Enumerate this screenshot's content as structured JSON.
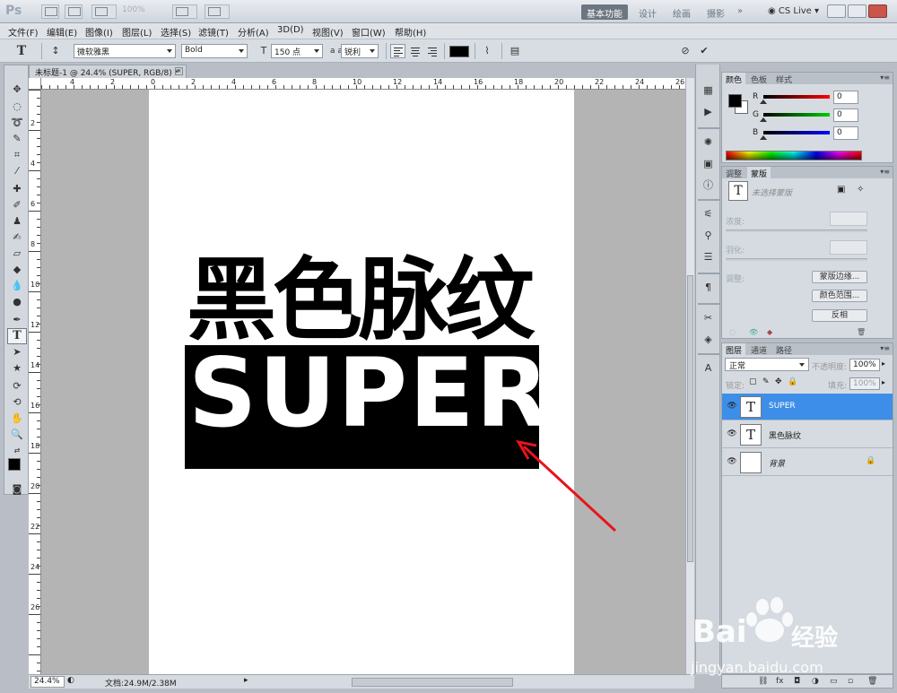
{
  "app": {
    "logo": "Ps",
    "zoom_level": "100%",
    "workspaces": [
      "基本功能",
      "设计",
      "绘画",
      "摄影"
    ],
    "cs_live": "CS Live"
  },
  "menu": [
    "文件(F)",
    "编辑(E)",
    "图像(I)",
    "图层(L)",
    "选择(S)",
    "滤镜(T)",
    "分析(A)",
    "3D(D)",
    "视图(V)",
    "窗口(W)",
    "帮助(H)"
  ],
  "options": {
    "font_family": "微软雅黑",
    "font_style": "Bold",
    "font_size": "150 点",
    "aa_label": "a a",
    "anti_alias": "锐利",
    "text_color": "#000000"
  },
  "document": {
    "tab_title": "未标题-1 @ 24.4% (SUPER, RGB/8) *",
    "headline": "黑色脉纹",
    "box_text": "SUPER",
    "zoom_status": "24.4%",
    "doc_status": "文档:24.9M/2.38M",
    "ruler_top": [
      "4",
      "2",
      "0",
      "2",
      "4",
      "6",
      "8",
      "10",
      "12",
      "14",
      "16",
      "18",
      "20",
      "22",
      "24",
      "26"
    ],
    "ruler_left": [
      "2",
      "4",
      "6",
      "8",
      "10",
      "12",
      "14",
      "16",
      "18",
      "20",
      "22",
      "24",
      "26"
    ]
  },
  "color_panel": {
    "tabs": [
      "颜色",
      "色板",
      "样式"
    ],
    "r": {
      "label": "R",
      "value": "0"
    },
    "g": {
      "label": "G",
      "value": "0"
    },
    "b": {
      "label": "B",
      "value": "0"
    }
  },
  "masks_panel": {
    "tabs": [
      "调整",
      "蒙版"
    ],
    "note": "未选择蒙版",
    "density_label": "浓度:",
    "feather_label": "羽化:",
    "refine_label": "调整:",
    "btn_mask_edge": "蒙版边缘...",
    "btn_color_range": "颜色范围...",
    "btn_invert": "反相"
  },
  "layers_panel": {
    "tabs": [
      "图层",
      "通道",
      "路径"
    ],
    "blend_mode": "正常",
    "opacity_label": "不透明度:",
    "opacity": "100%",
    "lock_label": "锁定:",
    "fill_label": "填充:",
    "fill": "100%",
    "layers": [
      {
        "name": "SUPER",
        "type": "T",
        "selected": true
      },
      {
        "name": "黑色脉纹",
        "type": "T",
        "selected": false
      },
      {
        "name": "背景",
        "type": "",
        "selected": false
      }
    ]
  },
  "watermark": {
    "brand": "Bai",
    "brand_cn": "经验",
    "url": "jingyan.baidu.com"
  },
  "colors": {
    "selected_layer": "#3d8ee8",
    "annotation_arrow": "#e8141b"
  }
}
